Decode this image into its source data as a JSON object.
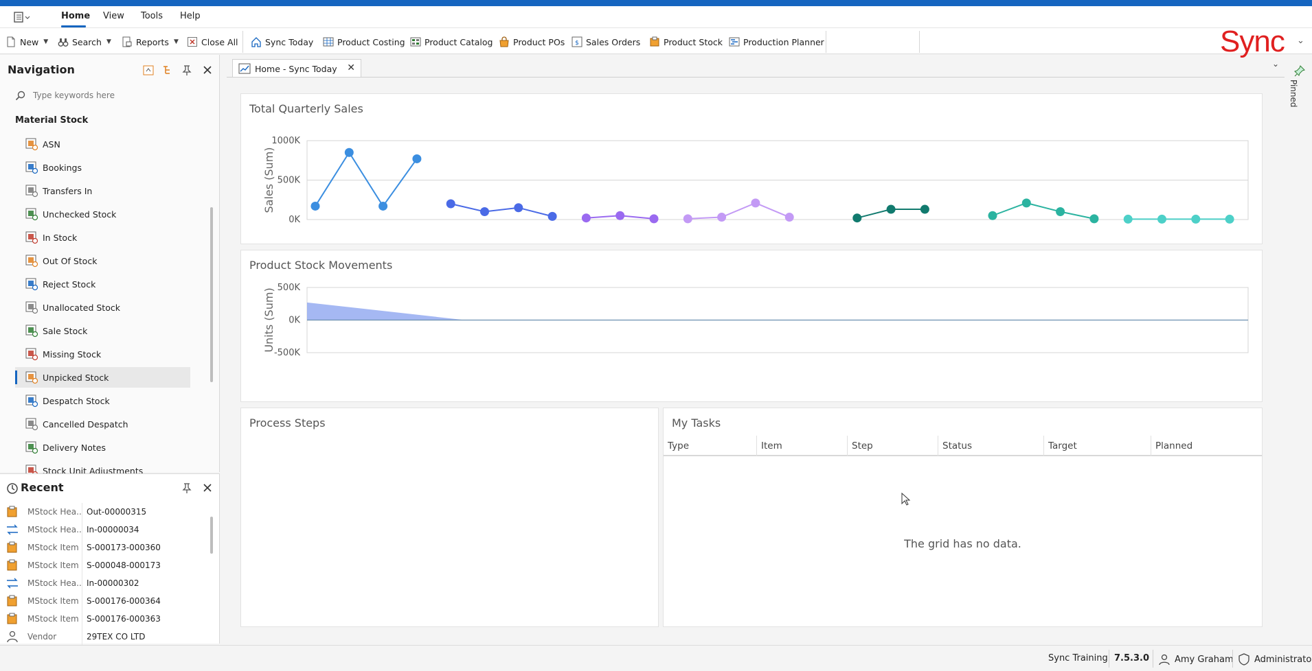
{
  "menu": {
    "items": [
      "Home",
      "View",
      "Tools",
      "Help"
    ],
    "active": "Home"
  },
  "toolbar": {
    "new_label": "New",
    "search_label": "Search",
    "reports_label": "Reports",
    "close_all_label": "Close All",
    "sync_today_label": "Sync Today",
    "product_costing_label": "Product Costing",
    "product_catalog_label": "Product Catalog",
    "product_pos_label": "Product POs",
    "sales_orders_label": "Sales Orders",
    "product_stock_label": "Product Stock",
    "production_planner_label": "Production Planner"
  },
  "brand": {
    "logo_text": "Sync",
    "color": "#e02020"
  },
  "navigation": {
    "title": "Navigation",
    "search_placeholder": "Type keywords here",
    "group_title": "Material Stock",
    "selected": "Unpicked Stock",
    "items": [
      {
        "label": "ASN",
        "icon": "asn-icon"
      },
      {
        "label": "Bookings",
        "icon": "bookings-icon"
      },
      {
        "label": "Transfers In",
        "icon": "transfers-in-icon"
      },
      {
        "label": "Unchecked Stock",
        "icon": "unchecked-stock-icon"
      },
      {
        "label": "In Stock",
        "icon": "in-stock-icon"
      },
      {
        "label": "Out Of Stock",
        "icon": "out-of-stock-icon"
      },
      {
        "label": "Reject Stock",
        "icon": "reject-stock-icon"
      },
      {
        "label": "Unallocated Stock",
        "icon": "unallocated-stock-icon"
      },
      {
        "label": "Sale Stock",
        "icon": "sale-stock-icon"
      },
      {
        "label": "Missing Stock",
        "icon": "missing-stock-icon"
      },
      {
        "label": "Unpicked Stock",
        "icon": "unpicked-stock-icon"
      },
      {
        "label": "Despatch Stock",
        "icon": "despatch-stock-icon"
      },
      {
        "label": "Cancelled Despatch",
        "icon": "cancelled-despatch-icon"
      },
      {
        "label": "Delivery Notes",
        "icon": "delivery-notes-icon"
      },
      {
        "label": "Stock Unit Adjustments",
        "icon": "stock-unit-adjustments-icon"
      }
    ]
  },
  "recent": {
    "title": "Recent",
    "rows": [
      {
        "type": "MStock Hea...",
        "value": "Out-00000315",
        "icon": "stock-header-icon"
      },
      {
        "type": "MStock Hea...",
        "value": "In-00000034",
        "icon": "transfer-icon"
      },
      {
        "type": "MStock Item",
        "value": "S-000173-000360",
        "icon": "stock-item-icon"
      },
      {
        "type": "MStock Item",
        "value": "S-000048-000173",
        "icon": "stock-item-icon"
      },
      {
        "type": "MStock Hea...",
        "value": "In-00000302",
        "icon": "transfer-icon"
      },
      {
        "type": "MStock Item",
        "value": "S-000176-000364",
        "icon": "stock-item-icon"
      },
      {
        "type": "MStock Item",
        "value": "S-000176-000363",
        "icon": "stock-item-icon"
      },
      {
        "type": "Vendor",
        "value": "29TEX CO LTD",
        "icon": "vendor-icon"
      }
    ]
  },
  "document_tab": {
    "label": "Home - Sync Today"
  },
  "pinned_label": "Pinned",
  "cards": {
    "sales_title": "Total Quarterly Sales",
    "stock_title": "Product Stock Movements",
    "process_title": "Process Steps",
    "tasks_title": "My Tasks"
  },
  "tasks": {
    "columns": [
      "Type",
      "Item",
      "Step",
      "Status",
      "Target",
      "Planned"
    ],
    "empty_text": "The grid has no data."
  },
  "status": {
    "db": "Sync Training",
    "version": "7.5.3.0",
    "user": "Amy Graham",
    "role": "Administrator"
  },
  "chart_data": [
    {
      "type": "line",
      "title": "Total Quarterly Sales",
      "ylabel": "Sales (Sum)",
      "ylim": [
        0,
        1000000
      ],
      "yticks": [
        "1000K",
        "500K",
        "0K"
      ],
      "grid": true,
      "series": [
        {
          "color": "#3b8ee0",
          "values": [
            170000,
            850000,
            170000,
            770000
          ]
        },
        {
          "color": "#4a6ae6",
          "values": [
            200000,
            100000,
            150000,
            40000
          ]
        },
        {
          "color": "#9a6af0",
          "values": [
            20000,
            50000,
            10000
          ]
        },
        {
          "color": "#c39af5",
          "values": [
            10000,
            30000,
            210000,
            30000
          ]
        },
        {
          "color": "#117a6e",
          "values": [
            20000,
            130000,
            130000
          ]
        },
        {
          "color": "#2bb3a0",
          "values": [
            50000,
            210000,
            100000,
            10000
          ]
        },
        {
          "color": "#4dd0c8",
          "values": [
            5000,
            5000,
            5000,
            5000
          ]
        }
      ]
    },
    {
      "type": "area",
      "title": "Product Stock Movements",
      "ylabel": "Units (Sum)",
      "ylim": [
        -500000,
        500000
      ],
      "yticks": [
        "500K",
        "0K",
        "-500K"
      ],
      "grid": true,
      "series": [
        {
          "color": "#8fa6f0",
          "values": [
            270000,
            0,
            0,
            0,
            0,
            0
          ]
        }
      ]
    }
  ]
}
